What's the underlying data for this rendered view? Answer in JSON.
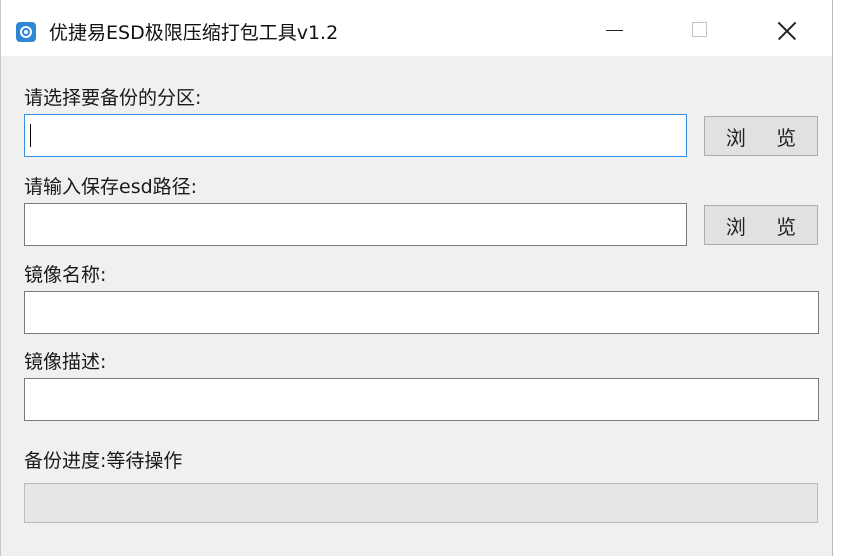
{
  "window": {
    "title": "优捷易ESD极限压缩打包工具v1.2",
    "icon": "app-disk-icon"
  },
  "form": {
    "partition_label": "请选择要备份的分区:",
    "partition_value": "",
    "browse_label": "浏 览",
    "esd_path_label": "请输入保存esd路径:",
    "esd_path_value": "",
    "image_name_label": "镜像名称:",
    "image_name_value": "",
    "image_desc_label": "镜像描述:",
    "image_desc_value": ""
  },
  "progress": {
    "label": "备份进度:等待操作",
    "value": 0
  },
  "colors": {
    "focus_border": "#3c8ee0",
    "window_bg": "#f0f0f0",
    "app_icon": "#2f86d6"
  }
}
